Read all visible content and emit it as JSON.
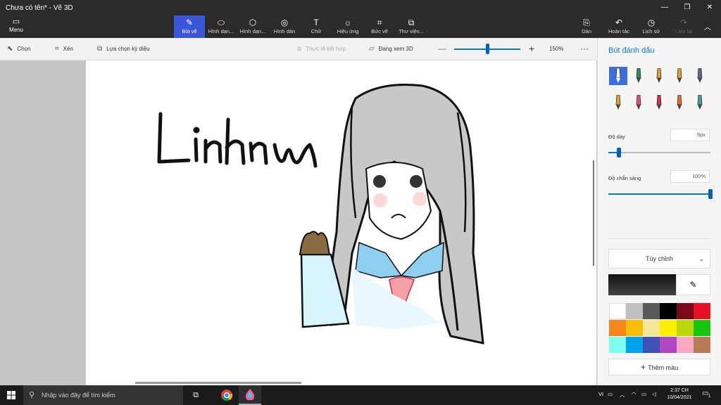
{
  "window": {
    "title": "Chưa có tên* - Vẽ 3D"
  },
  "ribbon": {
    "menu": "Menu",
    "tools": [
      {
        "label": "Bút vẽ",
        "icon": "brush-icon",
        "glyph": "✎",
        "active": true
      },
      {
        "label": "Hình dạn...",
        "icon": "2d-shapes-icon",
        "glyph": "⬭"
      },
      {
        "label": "Hình dạn...",
        "icon": "3d-shapes-icon",
        "glyph": "⬡"
      },
      {
        "label": "Hình dán",
        "icon": "stickers-icon",
        "glyph": "◎"
      },
      {
        "label": "Chữ",
        "icon": "text-icon",
        "glyph": "T"
      },
      {
        "label": "Hiệu ứng",
        "icon": "effects-icon",
        "glyph": "☼"
      },
      {
        "label": "Bức vẽ",
        "icon": "canvas-icon",
        "glyph": "⌗"
      },
      {
        "label": "Thư viện...",
        "icon": "3d-library-icon",
        "glyph": "⧉"
      }
    ],
    "right": [
      {
        "label": "Dán",
        "icon": "paste-icon",
        "glyph": "⎘"
      },
      {
        "label": "Hoàn tác",
        "icon": "undo-icon",
        "glyph": "↶"
      },
      {
        "label": "Lịch sử",
        "icon": "history-icon",
        "glyph": "◷"
      },
      {
        "label": "Làm lại",
        "icon": "redo-icon",
        "glyph": "↷",
        "disabled": true
      }
    ]
  },
  "toolbar": {
    "select": "Chọn",
    "crop": "Xén",
    "magic_select": "Lựa chọn kỳ diệu",
    "mixed_reality": "Thực tế kết hợp",
    "view_3d": "Đang xem 3D",
    "zoom": "150%",
    "zoom_fraction": 0.5
  },
  "panel": {
    "title": "Bút đánh dấu",
    "brushes": [
      {
        "icon": "marker-icon",
        "color": "#3b6fe0"
      },
      {
        "icon": "calligraphy-pen-icon",
        "color": "#2e8b57"
      },
      {
        "icon": "oil-brush-icon",
        "color": "#e0a030"
      },
      {
        "icon": "watercolor-icon",
        "color": "#e0a030"
      },
      {
        "icon": "pixel-pen-icon",
        "color": "#5a6a8a"
      },
      {
        "icon": "pencil-icon",
        "color": "#e0a030"
      },
      {
        "icon": "eraser-icon",
        "color": "#e05080"
      },
      {
        "icon": "crayon-icon",
        "color": "#d03050"
      },
      {
        "icon": "spray-can-icon",
        "color": "#e07020"
      },
      {
        "icon": "fill-icon",
        "color": "#40a0a0"
      }
    ],
    "thickness_label": "Độ dày",
    "thickness_value": "9px",
    "thickness_fraction": 0.1,
    "opacity_label": "Độ chắn sáng",
    "opacity_value": "100%",
    "opacity_fraction": 1.0,
    "finish": "Tùy chỉnh",
    "add_color": "Thêm màu",
    "palette": [
      "#ffffff",
      "#c0c0c0",
      "#595959",
      "#000000",
      "#7a0a1a",
      "#e81123",
      "#f7861e",
      "#fbbd09",
      "#f5e69a",
      "#fef000",
      "#bad80a",
      "#16c60c",
      "#7ffff0",
      "#00a2ed",
      "#3f51b5",
      "#b146c2",
      "#f7a8c4",
      "#b97a57"
    ]
  },
  "taskbar": {
    "search_placeholder": "Nhập vào đây để tìm kiếm",
    "lang": "VI",
    "time": "2:37 CH",
    "date": "10/04/2021",
    "notifications": "1"
  },
  "drawing": {
    "text": "Linhnw",
    "colors": {
      "hair": "#c8c8c8",
      "outline": "#111111",
      "collar": "#8fd0f0",
      "sleeve": "#d8f4fc",
      "bow": "#f4a0a8",
      "cheek": "#fcd0d0",
      "hand": "#8a6a40"
    }
  }
}
